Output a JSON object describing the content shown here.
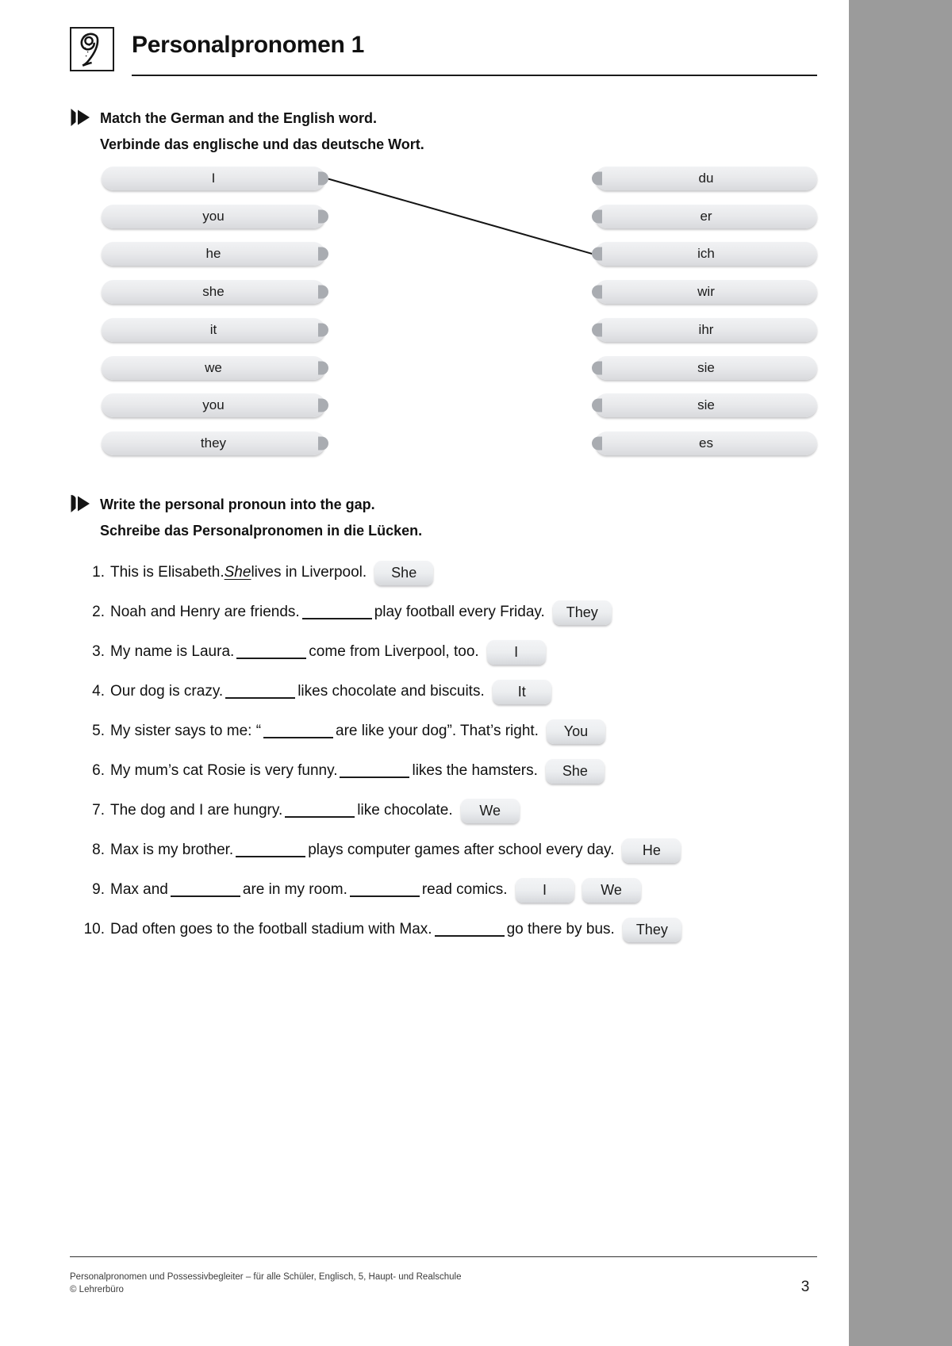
{
  "page": {
    "number": "3",
    "badge_glyph": "9",
    "title": "Personalpronomen 1"
  },
  "exercise1": {
    "marker": "1",
    "instruction_en": "Match the German and the English word.",
    "instruction_de": "Verbinde das englische und das deutsche Wort.",
    "left_column": [
      {
        "label": "I"
      },
      {
        "label": "you"
      },
      {
        "label": "he"
      },
      {
        "label": "she"
      },
      {
        "label": "it"
      },
      {
        "label": "we"
      },
      {
        "label": "you"
      },
      {
        "label": "they"
      }
    ],
    "right_column": [
      {
        "label": "du"
      },
      {
        "label": "er"
      },
      {
        "label": "ich"
      },
      {
        "label": "wir"
      },
      {
        "label": "ihr"
      },
      {
        "label": "sie"
      },
      {
        "label": "sie"
      },
      {
        "label": "es"
      }
    ],
    "connections": [
      {
        "from": "I",
        "to": "ich",
        "from_index": 0,
        "to_index": 2
      }
    ]
  },
  "exercise2": {
    "marker": "2",
    "instruction_en": "Write the personal pronoun into the gap.",
    "instruction_de": "Schreibe das Personalpronomen in die Lücken.",
    "items": [
      {
        "number": "1.",
        "before": "This is Elisabeth. ",
        "filled": "She",
        "after": " lives in Liverpool.",
        "answers": [
          "She"
        ]
      },
      {
        "number": "2.",
        "before": "Noah and Henry are friends.",
        "after": "play football every Friday.",
        "answers": [
          "They"
        ]
      },
      {
        "number": "3.",
        "before": "My name is Laura.",
        "after": "come from Liverpool, too.",
        "answers": [
          "I"
        ]
      },
      {
        "number": "4.",
        "before": "Our dog is crazy.",
        "after": "likes chocolate and biscuits.",
        "answers": [
          "It"
        ]
      },
      {
        "number": "5.",
        "before": "My sister says to me: “",
        "after": "are like your dog”. That’s right.",
        "answers": [
          "You"
        ]
      },
      {
        "number": "6.",
        "before": "My mum’s cat Rosie is very funny.",
        "after": "likes the hamsters.",
        "answers": [
          "She"
        ]
      },
      {
        "number": "7.",
        "before": "The dog and I are hungry.",
        "after": "like chocolate.",
        "answers": [
          "We"
        ]
      },
      {
        "number": "8.",
        "before": "Max is my brother.",
        "after": "plays computer games after school every day.",
        "answers": [
          "He"
        ]
      },
      {
        "number": "9.",
        "before": "Max and",
        "middle": "are in my room.",
        "after": "read comics.",
        "answers": [
          "I",
          "We"
        ]
      },
      {
        "number": "10.",
        "before": "Dad often goes to the football stadium with Max.",
        "after": "go there by bus.",
        "answers": [
          "They"
        ]
      }
    ]
  },
  "footer": {
    "line1": "Personalpronomen und Possessivbegleiter – für alle Schüler, Englisch, 5, Haupt- und Realschule",
    "line2": "© Lehrerbüro"
  },
  "colors": {
    "pill_fill": "#e9eaec",
    "pill_shadow": "#78787d",
    "nub": "#a9acb1",
    "ink": "#111111",
    "edge_strip": "#9b9b9b"
  }
}
